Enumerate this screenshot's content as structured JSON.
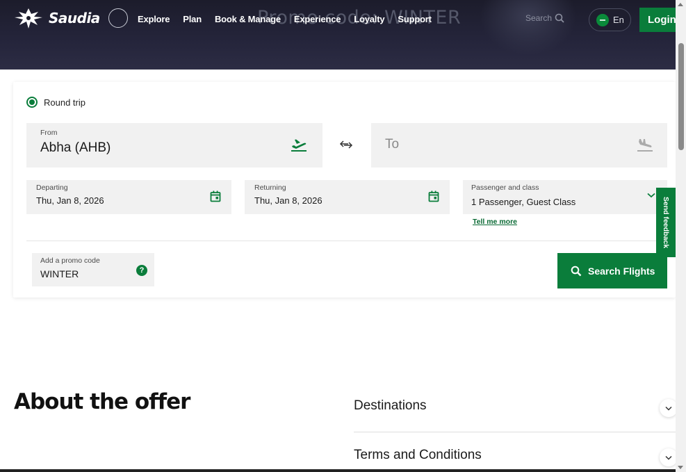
{
  "hero": {
    "title": "Promo code: WINTER"
  },
  "brand": {
    "name": "Saudia"
  },
  "nav": {
    "links": [
      "Explore",
      "Plan",
      "Book & Manage",
      "Experience",
      "Loyalty",
      "Support"
    ],
    "search_label": "Search",
    "lang": "En",
    "login": "Login"
  },
  "booking": {
    "trip_type": "Round trip",
    "from": {
      "label": "From",
      "value": "Abha (AHB)"
    },
    "to": {
      "placeholder": "To"
    },
    "departing": {
      "label": "Departing",
      "value": "Thu, Jan 8, 2026"
    },
    "returning": {
      "label": "Returning",
      "value": "Thu, Jan 8, 2026"
    },
    "passenger": {
      "label": "Passenger and class",
      "value": "1 Passenger, Guest Class",
      "link": "Tell me more"
    },
    "promo": {
      "label": "Add a promo code",
      "value": "WINTER",
      "help": "?"
    },
    "search_button": "Search Flights"
  },
  "feedback": "Send feedback",
  "about": {
    "title": "About the offer",
    "items": [
      "Destinations",
      "Terms and Conditions"
    ]
  },
  "colors": {
    "brand_green": "#0a7d3b",
    "hero_bg": "#1c1c2b"
  },
  "icons": [
    "departure-plane-icon",
    "swap-arrows-icon",
    "arrival-plane-icon",
    "calendar-icon",
    "chevron-down-icon",
    "help-icon",
    "search-icon",
    "flag-icon"
  ]
}
